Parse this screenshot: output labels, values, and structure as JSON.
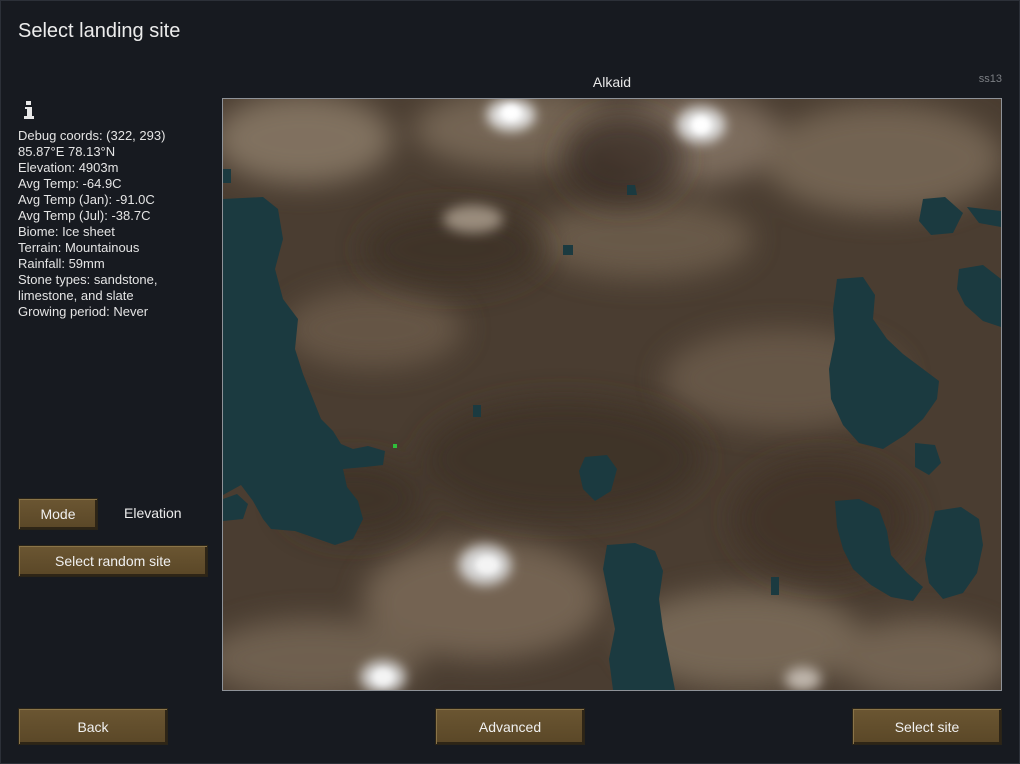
{
  "window": {
    "title": "Select landing site"
  },
  "map": {
    "title": "Alkaid",
    "seed": "ss13"
  },
  "info": {
    "lines": [
      "Debug coords: (322, 293)",
      "85.87°E 78.13°N",
      "Elevation: 4903m",
      "Avg Temp: -64.9C",
      "Avg Temp (Jan): -91.0C",
      "Avg Temp (Jul): -38.7C",
      "Biome: Ice sheet",
      "Terrain: Mountainous",
      "Rainfall: 59mm",
      "Stone types: sandstone, limestone, and slate",
      "Growing period: Never"
    ]
  },
  "controls": {
    "mode_button": "Mode",
    "mode_value": "Elevation",
    "random_button": "Select random site"
  },
  "footer": {
    "back": "Back",
    "advanced": "Advanced",
    "select": "Select site"
  },
  "colors": {
    "background": "#171a20",
    "button": "#5f4c2b",
    "water": "#1b3a40",
    "land": "#4d3f33",
    "snow": "#f2f2f2"
  },
  "icons": [
    "info-icon"
  ]
}
